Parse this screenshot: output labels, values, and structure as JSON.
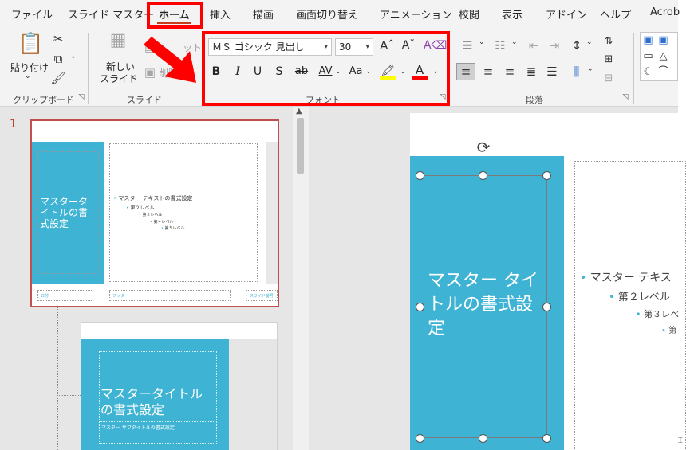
{
  "tabs": [
    "ファイル",
    "スライド マスター",
    "ホーム",
    "挿入",
    "描画",
    "画面切り替え",
    "アニメーション",
    "校閲",
    "表示",
    "アドイン",
    "ヘルプ",
    "Acrob"
  ],
  "active_tab": "ホーム",
  "clipboard": {
    "paste_label": "貼り付け",
    "group_label": "クリップボード"
  },
  "slides_group": {
    "new_slide_line1": "新しい",
    "new_slide_line2": "スライド",
    "layout_label": "ット",
    "delete_label": "削除",
    "group_label": "スライド"
  },
  "font_group": {
    "font_name": "ＭＳ ゴシック 見出し",
    "font_size": "30",
    "group_label": "フォント",
    "bold": "B",
    "italic": "I",
    "underline": "U",
    "shadow": "S",
    "strike": "ab",
    "spacing": "AV",
    "case": "Aa",
    "font_color": "A"
  },
  "paragraph_group": {
    "group_label": "段落"
  },
  "thumbnail1": {
    "number": "1",
    "title": "マスタータイトルの書式設定",
    "levels": [
      "マスター テキストの書式設定",
      "第２レベル",
      "第３レベル",
      "第４レベル",
      "第５レベル"
    ],
    "footer_date": "日付",
    "footer_text": "フッター",
    "footer_num": "スライド番号"
  },
  "thumbnail2": {
    "title": "マスタータイトルの書式設定",
    "subtitle": "マスター サブタイトルの書式設定"
  },
  "main_slide": {
    "title": "マスター タイトルの書式設定",
    "levels": [
      "マスター テキス",
      "第２レベル",
      "第３レベ",
      "第"
    ]
  },
  "colors": {
    "accent": "#c43e1c",
    "teal": "#3fb3d3",
    "highlight_red": "#ff0000"
  }
}
